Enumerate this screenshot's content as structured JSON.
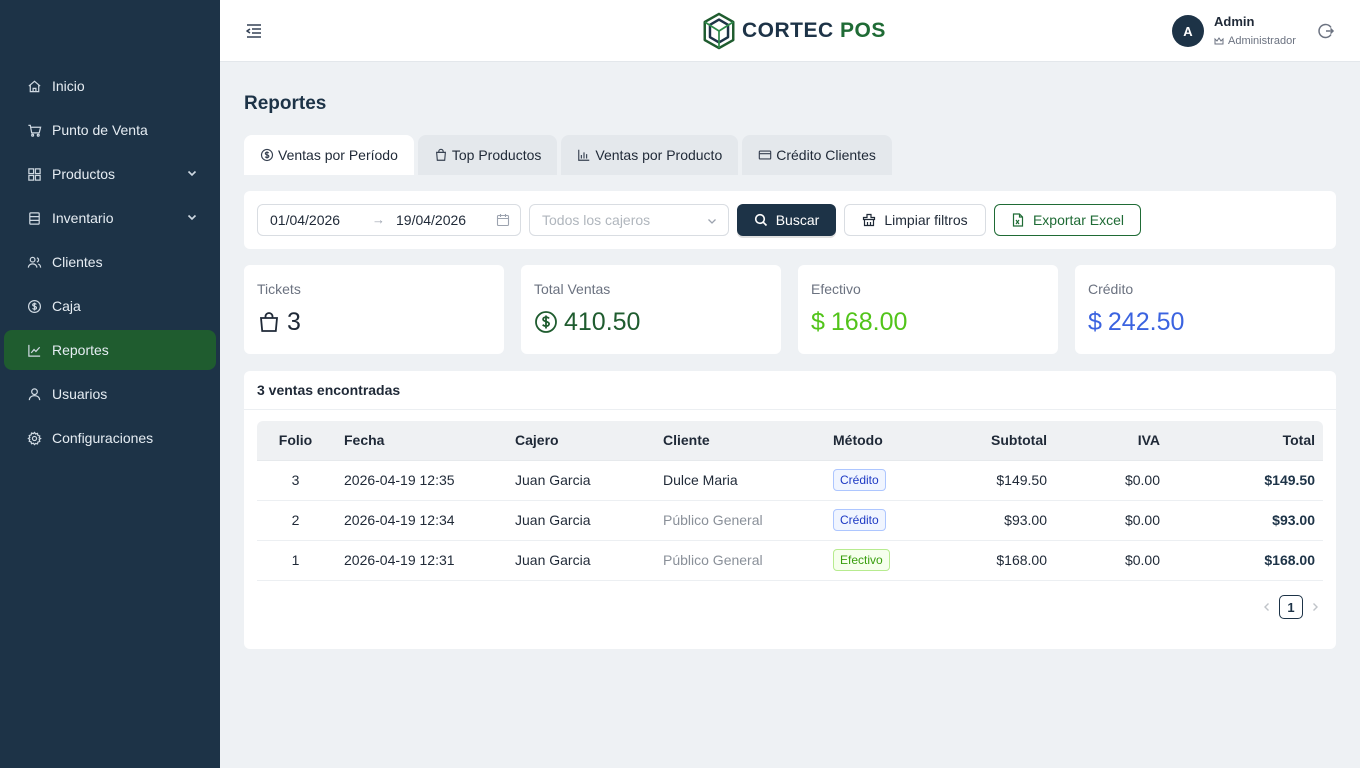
{
  "brand": {
    "name_part1": "CORTEC",
    "name_part2": "POS"
  },
  "user": {
    "initial": "A",
    "name": "Admin",
    "role": "Administrador"
  },
  "sidebar": {
    "items": [
      {
        "label": "Inicio"
      },
      {
        "label": "Punto de Venta"
      },
      {
        "label": "Productos"
      },
      {
        "label": "Inventario"
      },
      {
        "label": "Clientes"
      },
      {
        "label": "Caja"
      },
      {
        "label": "Reportes"
      },
      {
        "label": "Usuarios"
      },
      {
        "label": "Configuraciones"
      }
    ]
  },
  "page": {
    "title": "Reportes"
  },
  "tabs": [
    {
      "label": "Ventas por Período"
    },
    {
      "label": "Top Productos"
    },
    {
      "label": "Ventas por Producto"
    },
    {
      "label": "Crédito Clientes"
    }
  ],
  "filters": {
    "date_start": "01/04/2026",
    "date_end": "19/04/2026",
    "arrow": "→",
    "cashier_placeholder": "Todos los cajeros",
    "search_label": "Buscar",
    "clear_label": "Limpiar filtros",
    "export_label": "Exportar Excel"
  },
  "stats": {
    "tickets": {
      "label": "Tickets",
      "value": "3"
    },
    "total": {
      "label": "Total Ventas",
      "value": "410.50"
    },
    "cash": {
      "label": "Efectivo",
      "currency": "$",
      "value": "168.00"
    },
    "credit": {
      "label": "Crédito",
      "currency": "$",
      "value": "242.50"
    }
  },
  "colors": {
    "accent_green": "#1f5c2f",
    "sidebar_bg": "#1d3347",
    "cash_green": "#52c41a",
    "credit_blue": "#3b63e0"
  },
  "results": {
    "count_label": "3 ventas encontradas",
    "columns": {
      "folio": "Folio",
      "fecha": "Fecha",
      "cajero": "Cajero",
      "cliente": "Cliente",
      "metodo": "Método",
      "subtotal": "Subtotal",
      "iva": "IVA",
      "total": "Total"
    },
    "rows": [
      {
        "folio": "3",
        "fecha": "2026-04-19 12:35",
        "cajero": "Juan Garcia",
        "cliente": "Dulce Maria",
        "metodo": "Crédito",
        "subtotal": "$149.50",
        "iva": "$0.00",
        "total": "$149.50"
      },
      {
        "folio": "2",
        "fecha": "2026-04-19 12:34",
        "cajero": "Juan Garcia",
        "cliente": "Público General",
        "metodo": "Crédito",
        "subtotal": "$93.00",
        "iva": "$0.00",
        "total": "$93.00"
      },
      {
        "folio": "1",
        "fecha": "2026-04-19 12:31",
        "cajero": "Juan Garcia",
        "cliente": "Público General",
        "metodo": "Efectivo",
        "subtotal": "$168.00",
        "iva": "$0.00",
        "total": "$168.00"
      }
    ]
  },
  "pagination": {
    "current": "1"
  }
}
